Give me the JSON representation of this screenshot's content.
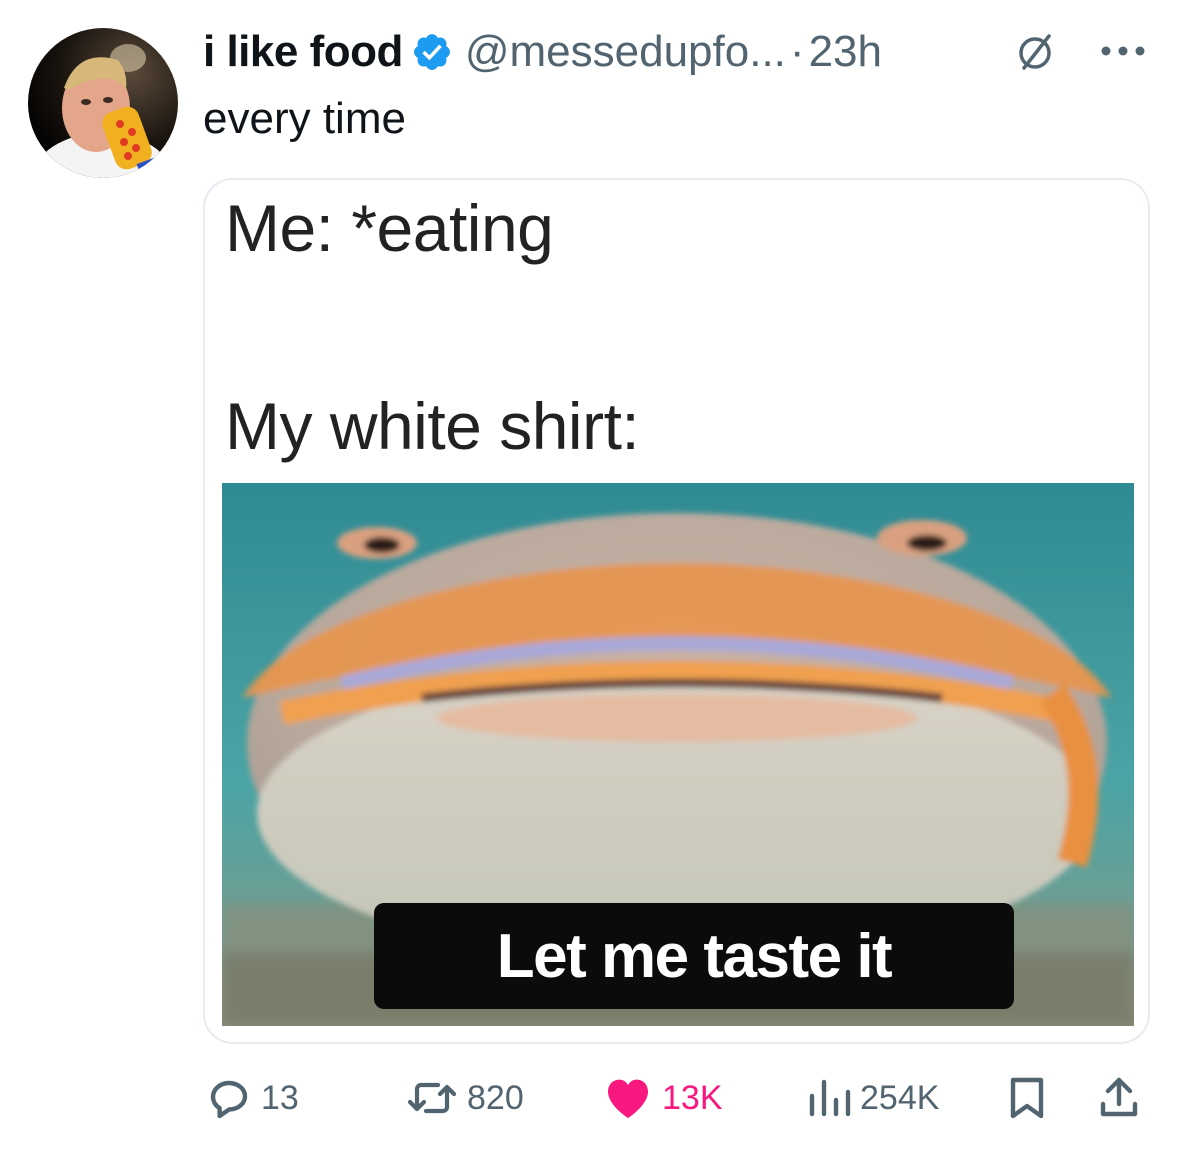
{
  "post": {
    "display_name": "i like food",
    "handle": "@messedupfo...",
    "separator": "·",
    "time": "23h",
    "text": "every time"
  },
  "meme": {
    "line1": "Me: *eating",
    "line2": "My white shirt:",
    "caption": "Let me taste it"
  },
  "actions": {
    "replies": "13",
    "reposts": "820",
    "likes": "13K",
    "views": "254K"
  },
  "icons": [
    "verified-badge-icon",
    "grok-icon",
    "more-icon",
    "reply-icon",
    "repost-icon",
    "heart-icon",
    "views-icon",
    "bookmark-icon",
    "share-icon"
  ],
  "colors": {
    "verified": "#1d9bf0",
    "like": "#f91880",
    "secondary_text": "#536471"
  }
}
